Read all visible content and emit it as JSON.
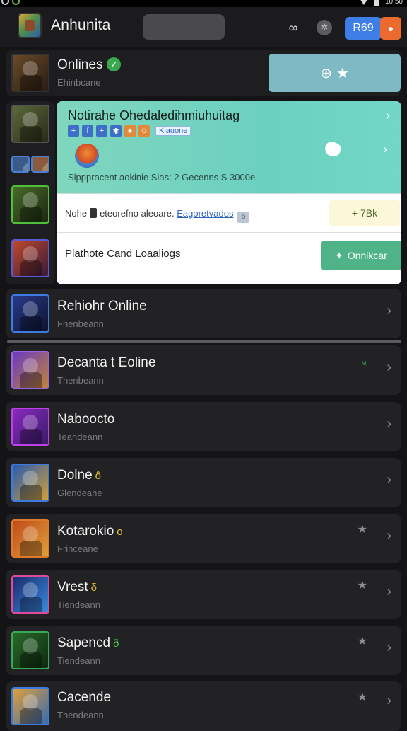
{
  "status_bar": {
    "time": "10:50"
  },
  "header": {
    "title": "Anhunita",
    "badge_label": "R69"
  },
  "first_card": {
    "title": "Onlines",
    "subtitle": "Ehinbcane"
  },
  "panel": {
    "title": "Notirahe Ohedaledihmiuhuitag",
    "tag": "Kiauone",
    "stats": "Sipppracent aokinie Sias: 2  Gecenns S 3000e",
    "row2_text": "Nohe",
    "row2_middle": "eteorefno aleoare.",
    "row2_link": "Eagoretvados",
    "row2_button": "7Bk",
    "row3_text": "Plathote Cand Loaaliogs",
    "row3_button": "Onnikcar"
  },
  "games": [
    {
      "title": "Rehiohr Online",
      "subtitle": "Fhenbeann",
      "tag": "",
      "accent": "#3d7be0"
    },
    {
      "title": "Decanta t Eoline",
      "subtitle": "Thenbeann",
      "tag": "",
      "accent": "#9a63e0"
    },
    {
      "title": "Naboocto",
      "subtitle": "Teandeann",
      "tag": "",
      "accent": "#c040e8"
    },
    {
      "title": "Dolne",
      "subtitle": "Glendeane",
      "tag": "ô",
      "accent": "#3d7be0"
    },
    {
      "title": "Kotarokio",
      "subtitle": "Frinceane",
      "tag": "o",
      "accent": "#e07a2a"
    },
    {
      "title": "Vrest",
      "subtitle": "Tiendeann",
      "tag": "δ",
      "accent": "#e04a9a"
    },
    {
      "title": "Sapencd",
      "subtitle": "Tiendeann",
      "tag": "ð",
      "accent": "#3aa85a"
    },
    {
      "title": "Cacende",
      "subtitle": "Thendeann",
      "tag": "",
      "accent": "#3d7be0"
    }
  ]
}
